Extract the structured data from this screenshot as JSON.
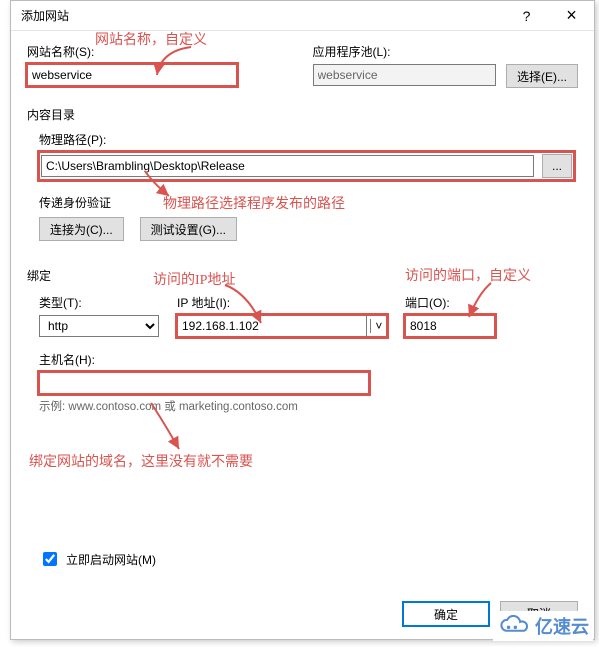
{
  "title": "添加网站",
  "labels": {
    "site_name": "网站名称(S):",
    "app_pool": "应用程序池(L):",
    "select_btn": "选择(E)...",
    "content_dir": "内容目录",
    "phys_path": "物理路径(P):",
    "browse": "...",
    "pass_auth": "传递身份验证",
    "connect_as": "连接为(C)...",
    "test_settings": "测试设置(G)...",
    "binding": "绑定",
    "type": "类型(T):",
    "ip_addr": "IP 地址(I):",
    "port": "端口(O):",
    "hostname": "主机名(H):",
    "example": "示例: www.contoso.com 或 marketing.contoso.com",
    "start_now": "立即启动网站(M)",
    "ok": "确定",
    "cancel": "取消"
  },
  "values": {
    "site_name": "webservice",
    "app_pool": "webservice",
    "phys_path": "C:\\Users\\Brambling\\Desktop\\Release",
    "type": "http",
    "ip": "192.168.1.102",
    "port": "8018",
    "hostname": "",
    "start_now_checked": true
  },
  "annotations": {
    "a1": "网站名称，自定义",
    "a2": "物理路径选择程序发布的路径",
    "a3": "访问的IP地址",
    "a4": "访问的端口，自定义",
    "a5": "绑定网站的域名，这里没有就不需要"
  },
  "logo_text": "亿速云"
}
